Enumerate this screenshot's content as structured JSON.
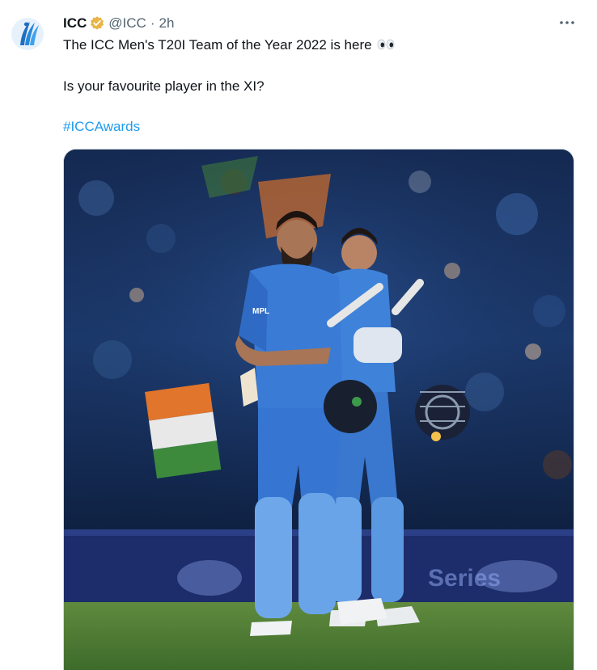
{
  "tweet": {
    "author_name": "ICC",
    "verified": true,
    "handle": "@ICC",
    "separator": "·",
    "time": "2h",
    "text_line1": "The ICC Men's T20I Team of the Year 2022 is here",
    "emoji": "eyes",
    "text_line2": "Is your favourite player in the XI?",
    "hashtag": "#ICCAwards",
    "media": {
      "alt": "Two Indian cricketers walking off the field carrying bats and helmets",
      "jersey_text": "MPL",
      "board_text": "Series"
    }
  },
  "colors": {
    "link": "#1d9bf0",
    "badge": "#e8b54a",
    "secondary_text": "#536471",
    "jersey": "#3f82d9"
  },
  "icons": [
    "icc-logo-icon",
    "verified-badge-icon",
    "more-options-icon",
    "eyes-emoji-icon"
  ]
}
